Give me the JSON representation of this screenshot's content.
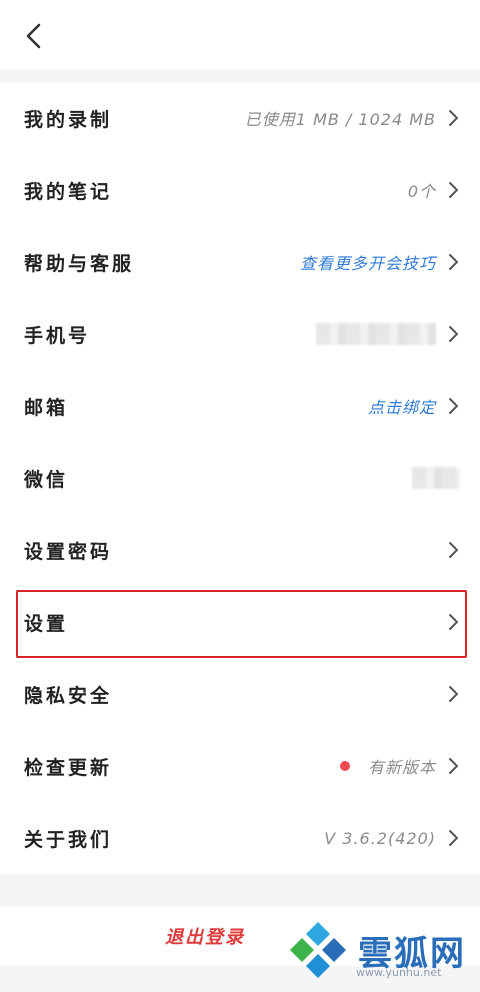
{
  "header": {
    "back_icon": "chevron-left-icon"
  },
  "menu": {
    "recording": {
      "label": "我的录制",
      "value": "已使用1 MB / 1024 MB"
    },
    "notes": {
      "label": "我的笔记",
      "value": "0个"
    },
    "help": {
      "label": "帮助与客服",
      "value": "查看更多开会技巧"
    },
    "phone": {
      "label": "手机号"
    },
    "email": {
      "label": "邮箱",
      "value": "点击绑定"
    },
    "wechat": {
      "label": "微信"
    },
    "password": {
      "label": "设置密码"
    },
    "settings": {
      "label": "设置"
    },
    "privacy": {
      "label": "隐私安全"
    },
    "update": {
      "label": "检查更新",
      "value": "有新版本"
    },
    "about": {
      "label": "关于我们",
      "value": "V 3.6.2(420)"
    }
  },
  "logout": {
    "label": "退出登录"
  },
  "watermark": {
    "text": "雲狐网",
    "url": "www.yunhu.net"
  },
  "colors": {
    "accent_blue": "#2f7ad6",
    "logout_red": "#e03b3b",
    "update_dot": "#ef4b52",
    "highlight_box": "#d8222a"
  }
}
